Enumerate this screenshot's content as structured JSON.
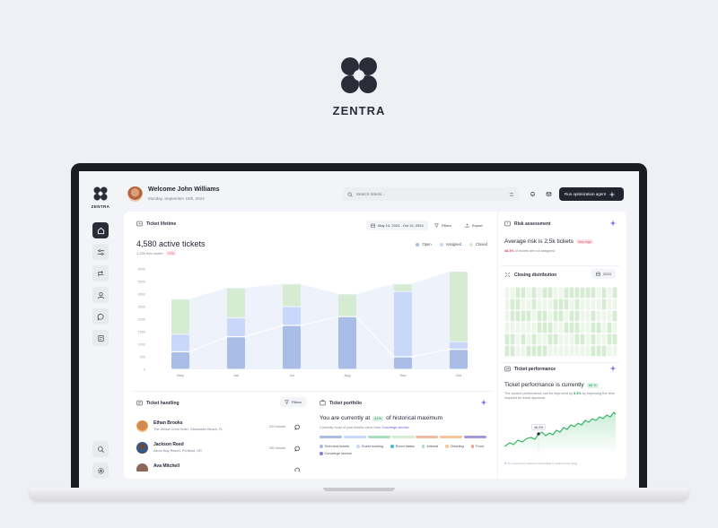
{
  "brand": {
    "name": "ZENTRA"
  },
  "sidebar": {
    "brand": "ZENTRA",
    "items": [
      {
        "icon": "home-icon"
      },
      {
        "icon": "sliders-icon"
      },
      {
        "icon": "routes-icon"
      },
      {
        "icon": "user-icon"
      },
      {
        "icon": "chat-icon"
      },
      {
        "icon": "report-icon"
      }
    ],
    "bottom": [
      {
        "icon": "search-icon"
      },
      {
        "icon": "gear-icon"
      }
    ]
  },
  "header": {
    "welcome": "Welcome John Williams",
    "date": "Monday, September 19th, 2024",
    "search_placeholder": "Search tickets...",
    "run_button": "Run optimization agent"
  },
  "lifetime": {
    "title": "Ticket lifetime",
    "date_range": "May 14, 2024 - Oct 14, 2024",
    "filters": "Filters",
    "export": "Export",
    "active": "4,580 active tickets",
    "sub": "1,230 this month",
    "sub_badge": "+7%",
    "legend": [
      "Open",
      "Assigned",
      "Closed"
    ]
  },
  "chart_data": {
    "type": "bar",
    "categories": [
      "May",
      "Jun",
      "Jul",
      "Aug",
      "Sep",
      "Oct"
    ],
    "y_ticks": [
      "0",
      "500",
      "1000",
      "1500",
      "2000",
      "2500",
      "3000",
      "3500",
      "4000"
    ],
    "ylim": [
      0,
      4000
    ],
    "stacked": true,
    "series": [
      {
        "name": "Open",
        "color": "#a9bde6",
        "values": [
          700,
          1300,
          1750,
          2100,
          500,
          800
        ]
      },
      {
        "name": "Assigned",
        "color": "#c9d8fa",
        "values": [
          700,
          750,
          750,
          0,
          2600,
          300
        ]
      },
      {
        "name": "Closed",
        "color": "#d6ecd2",
        "values": [
          1400,
          1200,
          900,
          900,
          300,
          2800
        ]
      }
    ]
  },
  "handling": {
    "title": "Ticket handling",
    "filters": "Filters",
    "rows": [
      {
        "name": "Ethan Brooks",
        "address": "The Willow Crest Hotel, Clearwater Beach, FL",
        "count": "229 tickets"
      },
      {
        "name": "Jackson Reed",
        "address": "Azure Bay Resort, Portland, OR",
        "count": "250 tickets"
      },
      {
        "name": "Ava Mitchell",
        "address": "",
        "count": ""
      }
    ]
  },
  "portfolio": {
    "title": "Ticket portfolio",
    "headline_pre": "You are currently at",
    "headline_badge": "81%",
    "headline_post": "of historical maximum",
    "sub_pre": "Currently most of your tickets come from",
    "sub_link": "Concierge service",
    "bar_colors": [
      "#a9bde6",
      "#c9d8fa",
      "#a8dfc2",
      "#d6ecd2",
      "#f4b7a0",
      "#f7c59a",
      "#a696d9"
    ],
    "legend": [
      {
        "label": "Technical tickets",
        "color": "#a9bde6"
      },
      {
        "label": "Guest booking",
        "color": "#c9d8fa"
      },
      {
        "label": "Room status",
        "color": "#46c2c7"
      },
      {
        "label": "Internal",
        "color": "#a8dfc2"
      },
      {
        "label": "Cleaning",
        "color": "#f7c59a"
      },
      {
        "label": "Food",
        "color": "#f4a08a"
      },
      {
        "label": "Concierge service",
        "color": "#8f7fd0"
      }
    ]
  },
  "risk": {
    "title": "Risk assessment",
    "headline": "Average risk is 2,5k tickets",
    "badge": "Very high",
    "sub_value": "48.3%",
    "sub_text": "of tickets are not assigned"
  },
  "closing": {
    "title": "Closing distribution",
    "year": "2024"
  },
  "performance": {
    "title": "Ticket performance",
    "headline": "Ticket performance is currently",
    "badge": "68 %",
    "sub_pre": "The current performance can be improved by",
    "sub_value": "5,3%",
    "sub_post": "by improving the time required for ticket approval.",
    "point_label": "46,3%",
    "footer": "Try running the customer flow builder to improve this rating"
  },
  "colors": {
    "accent_dark": "#22252e",
    "star": "#6c4ce0"
  }
}
